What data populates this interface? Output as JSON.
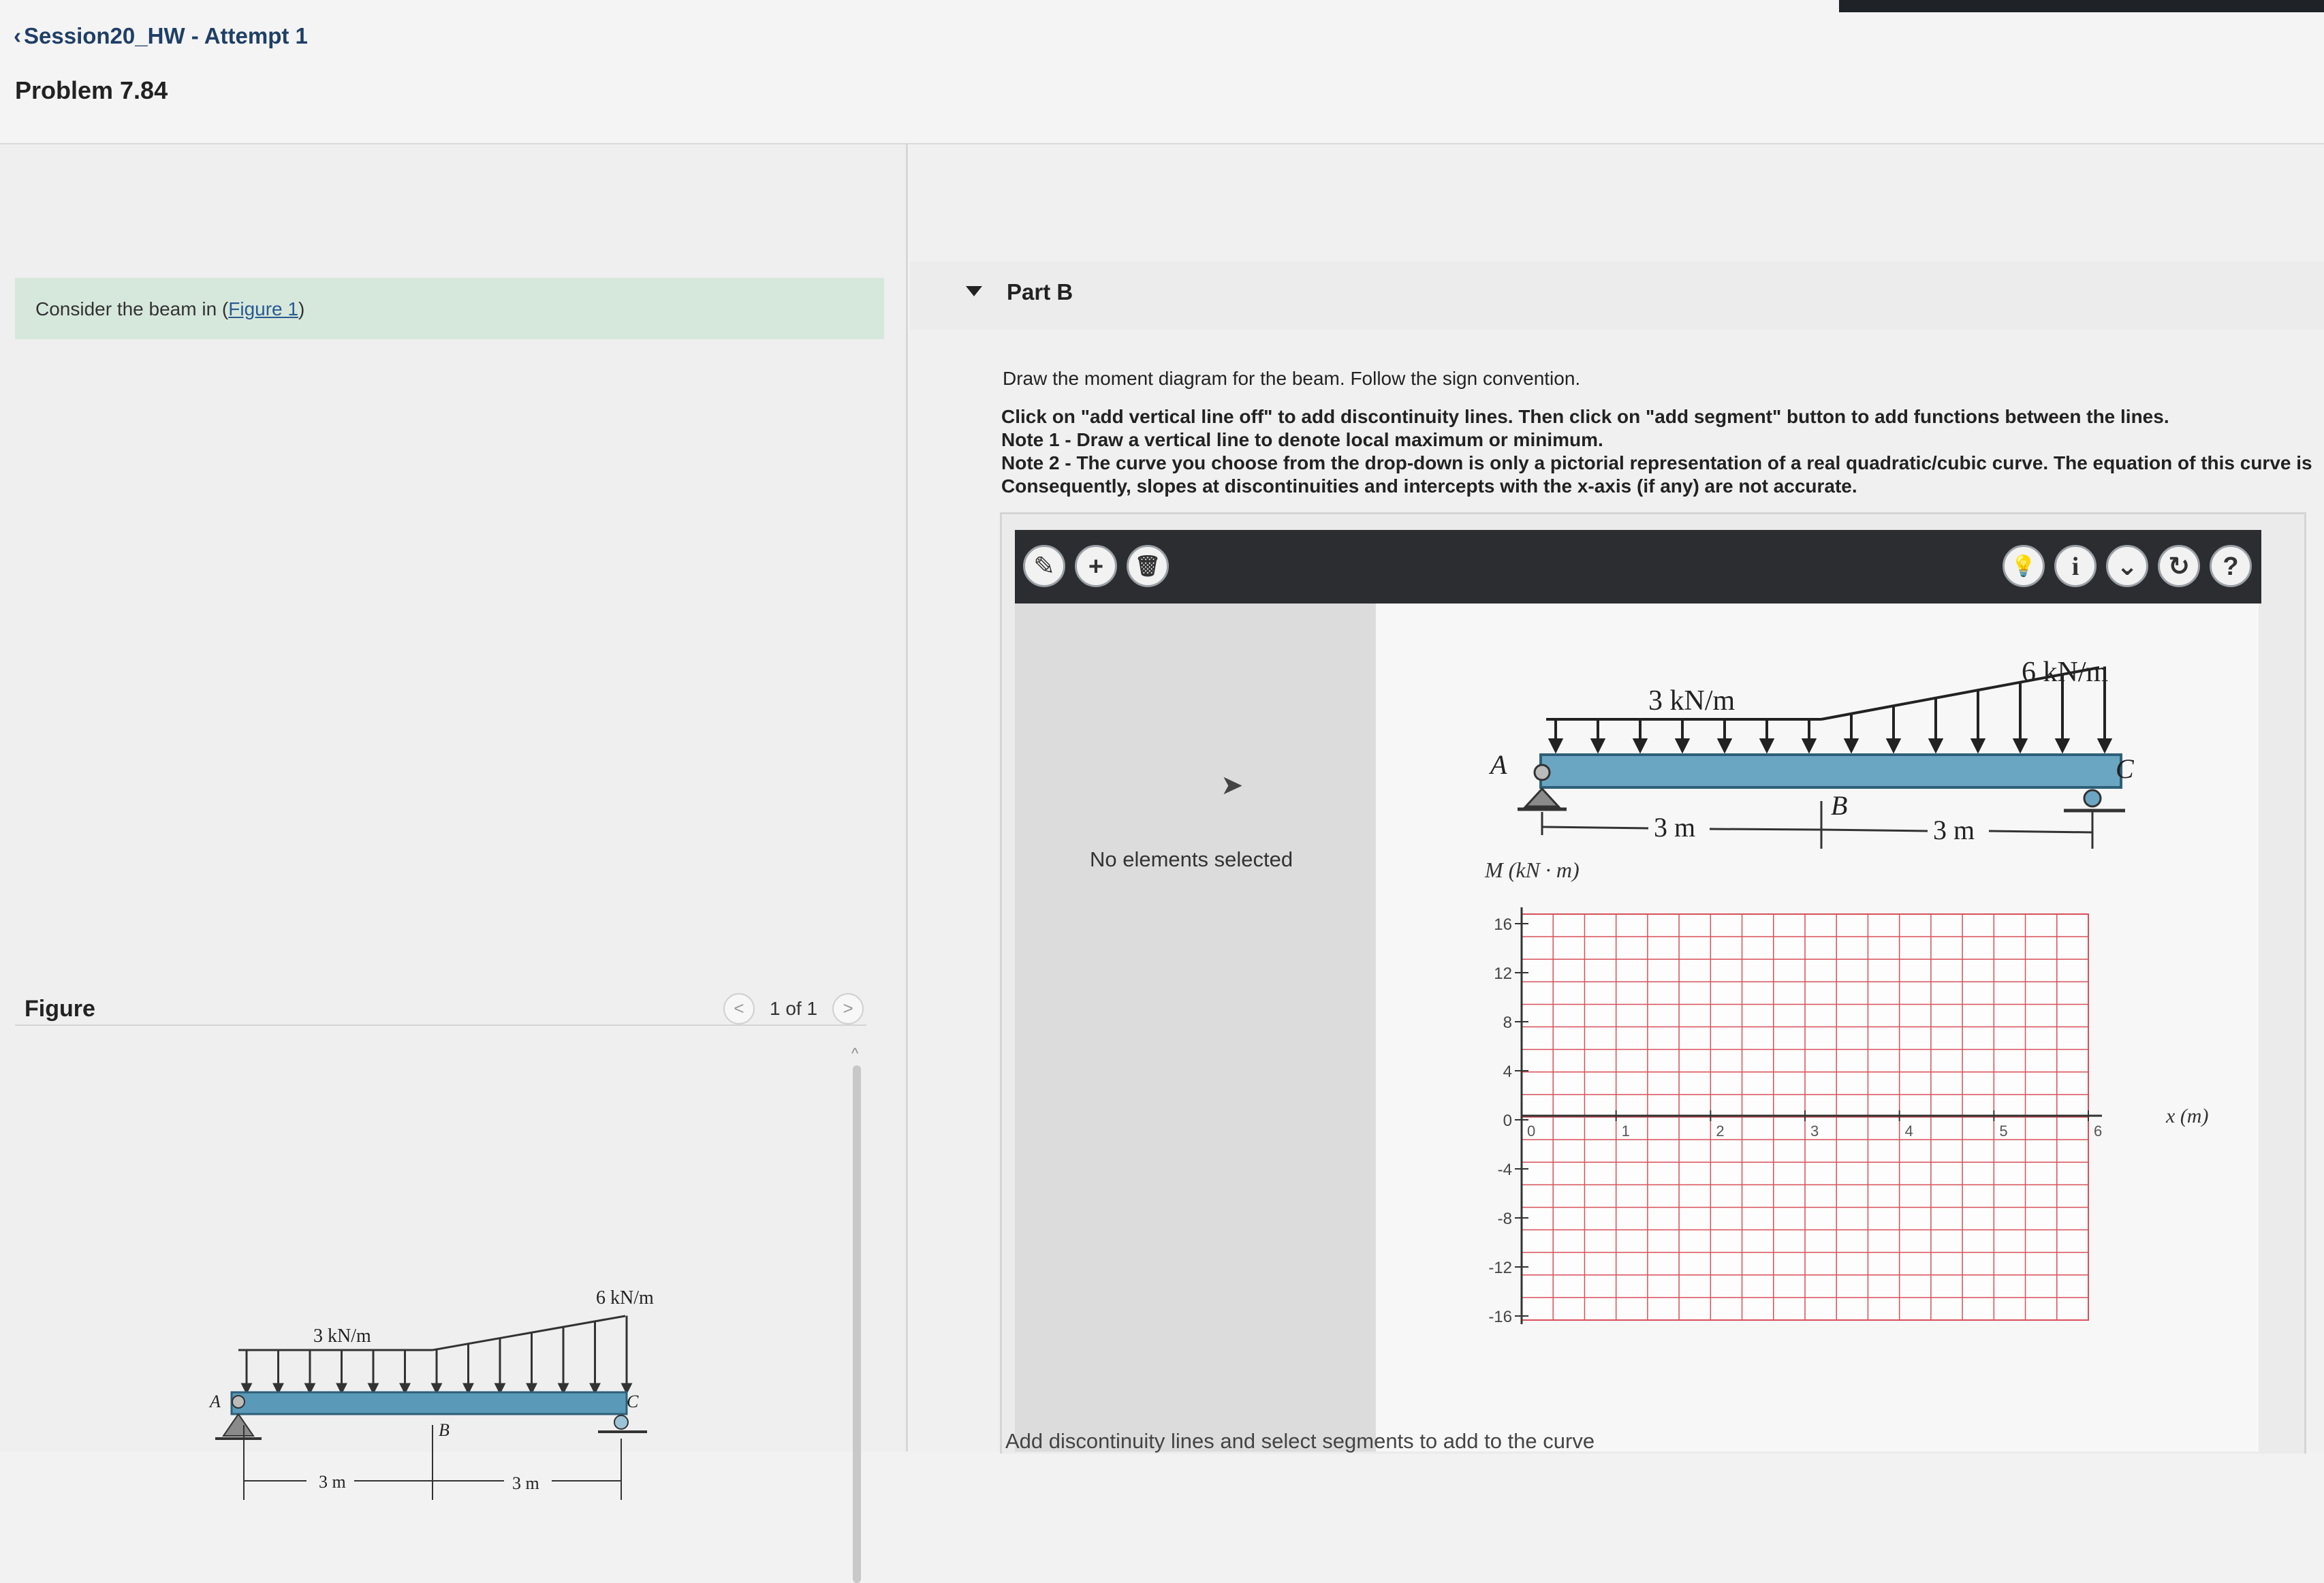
{
  "header": {
    "back_label": "Session20_HW - Attempt 1",
    "problem_title": "Problem 7.84"
  },
  "left": {
    "prompt_prefix": "Consider the beam in (",
    "prompt_link": "Figure 1",
    "prompt_suffix": ")",
    "figure_label": "Figure",
    "pager": {
      "prev": "<",
      "count": "1 of 1",
      "next": ">"
    },
    "figure": {
      "load_left": "3 kN/m",
      "load_right": "6 kN/m",
      "point_a": "A",
      "point_b": "B",
      "point_c": "C",
      "dim_left": "3 m",
      "dim_right": "3 m"
    }
  },
  "part": {
    "title": "Part B",
    "instructions": [
      "Draw the moment diagram for the beam. Follow the sign convention.",
      "Click on \"add vertical line off\" to add discontinuity lines. Then click on \"add segment\" button to add functions between the lines.",
      "Note 1 - Draw a vertical line to denote local maximum or minimum.",
      "Note 2 - The curve you choose from the drop-down is only a pictorial representation of a real quadratic/cubic curve. The equation of this curve is",
      "Consequently, slopes at discontinuities and intercepts with the x-axis (if any) are not accurate."
    ]
  },
  "tool": {
    "left_buttons": [
      {
        "name": "add-vertical-line-button",
        "glyph": "✎"
      },
      {
        "name": "add-segment-button",
        "glyph": "+"
      },
      {
        "name": "delete-button",
        "glyph": "🗑"
      }
    ],
    "right_buttons": [
      {
        "name": "hint-button",
        "glyph": "💡"
      },
      {
        "name": "info-button",
        "glyph": "i"
      },
      {
        "name": "more-button",
        "glyph": "⌄"
      },
      {
        "name": "reset-button",
        "glyph": "↻"
      },
      {
        "name": "help-button",
        "glyph": "?"
      }
    ],
    "no_selection": "No elements selected",
    "bottom_note": "Add discontinuity lines and select segments to add to the curve"
  },
  "diagram": {
    "load_left": "3 kN/m",
    "load_right": "6 kN/m",
    "point_a": "A",
    "point_b": "B",
    "point_c": "C",
    "dim_left": "3 m",
    "dim_right": "3 m",
    "y_axis_label": "M (kN · m)",
    "x_axis_label": "x (m)",
    "y_ticks": [
      "16",
      "12",
      "8",
      "4",
      "0",
      "-4",
      "-8",
      "-12",
      "-16"
    ],
    "x_ticks": [
      "0",
      "1",
      "2",
      "3",
      "4",
      "5",
      "6"
    ]
  },
  "colors": {
    "beam": "#5a9ab8",
    "grid": "#d7505a",
    "toolbar": "#2b2d30",
    "prompt_bg": "#d6e7dc",
    "link": "#2a5a8f"
  }
}
